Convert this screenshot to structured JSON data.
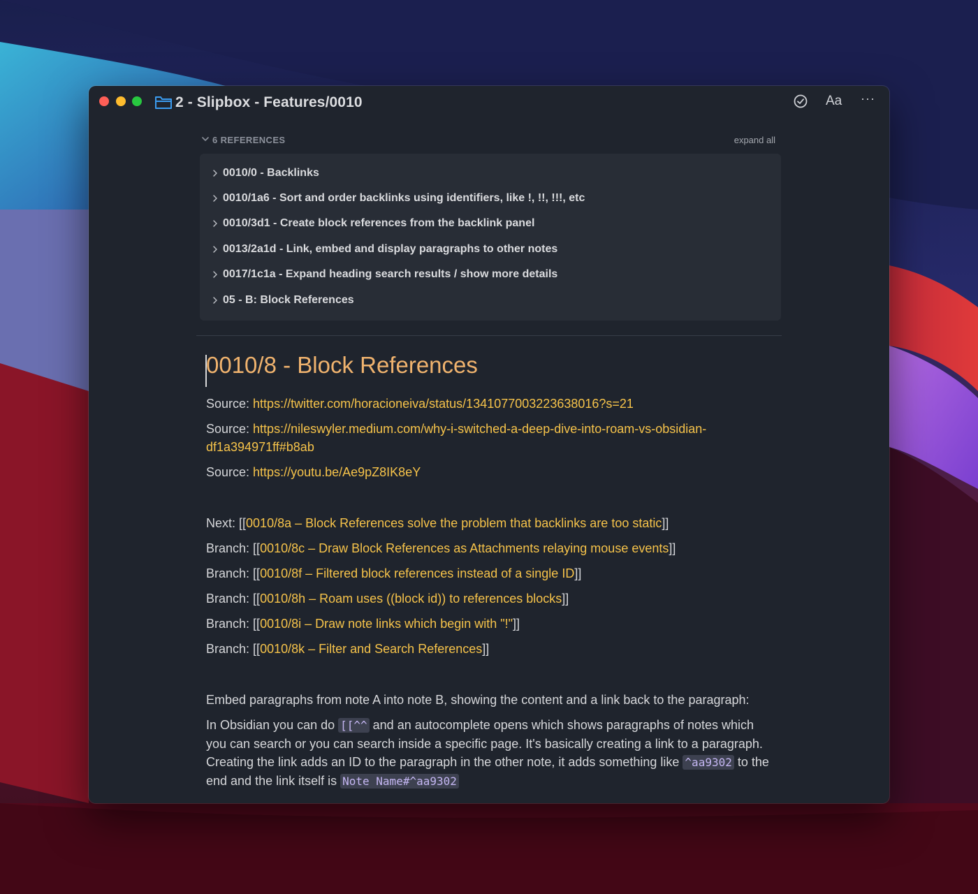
{
  "window": {
    "title": "2 - Slipbox - Features/0010"
  },
  "toolbar": {
    "aa_label": "Aa",
    "more_label": "···"
  },
  "references": {
    "count_label": "6 REFERENCES",
    "expand_all": "expand all",
    "items": [
      "0010/0 - Backlinks",
      "0010/1a6 - Sort and order backlinks using identifiers, like !, !!, !!!, etc",
      "0010/3d1 - Create block references from the backlink panel",
      "0013/2a1d - Link, embed and display paragraphs to other notes",
      "0017/1c1a - Expand heading search results / show more details",
      "05 - B: Block References"
    ]
  },
  "note": {
    "title": "0010/8 - Block References",
    "sources": {
      "prefix": "Source: ",
      "s1": "https://twitter.com/horacioneiva/status/1341077003223638016?s=21",
      "s2_line1": "https://nileswyler.medium.com/why-i-switched-a-deep-dive-into-roam-vs-obsidian-",
      "s2_line2": "df1a394971ff#b8ab",
      "s3": "https://youtu.be/Ae9pZ8IK8eY"
    },
    "links": {
      "open": "[[",
      "close": "]]",
      "next_prefix": "Next: ",
      "branch_prefix": "Branch: ",
      "next": "0010/8a – Block References solve the problem that backlinks are too static",
      "b1": "0010/8c – Draw Block References as Attachments relaying mouse events",
      "b2": "0010/8f – Filtered block references instead of a single ID",
      "b3": "0010/8h – Roam uses ((block id)) to references blocks",
      "b4": "0010/8i – Draw note links which begin with \"!\"",
      "b5": "0010/8k – Filter and Search References"
    },
    "body": {
      "p1": "Embed paragraphs from note A into note B, showing the content and a link back to the paragraph:",
      "p2_a": "In Obsidian you can do ",
      "p2_code1": "[[^^",
      "p2_b": " and an autocomplete opens which shows paragraphs of notes which you can search or you can search inside a specific page. It's basically creating a link to a paragraph. Creating the link adds an ID to the paragraph in the other note, it adds something like ",
      "p2_code2": "^aa9302",
      "p2_c": " to the end and the link itself is ",
      "p2_code3": "Note Name#^aa9302"
    }
  }
}
